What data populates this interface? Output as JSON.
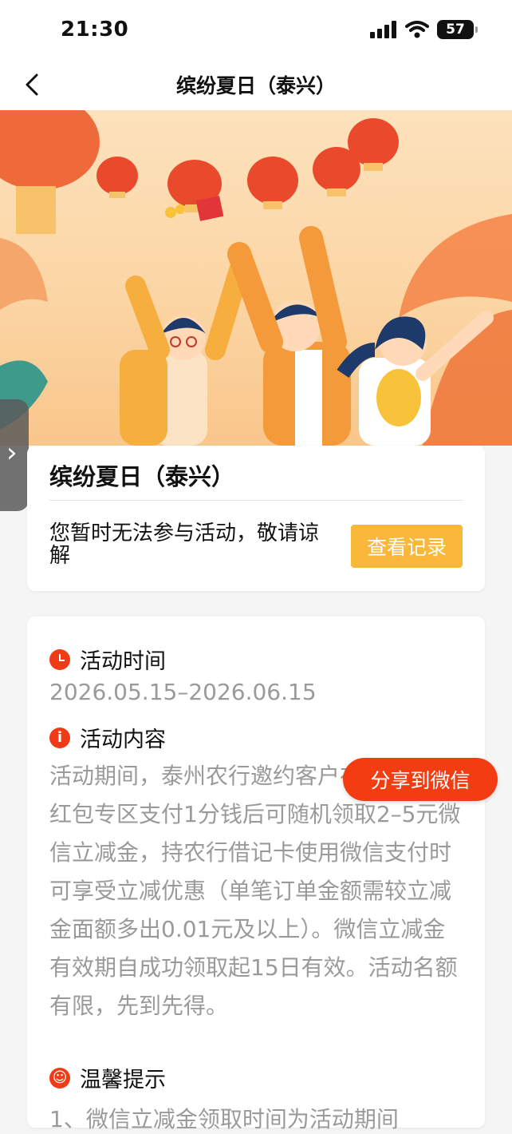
{
  "status_bar": {
    "time": "21:30",
    "battery": "57"
  },
  "nav": {
    "title": "缤纷夏日（泰兴）"
  },
  "info_card": {
    "title": "缤纷夏日（泰兴）",
    "message": "您暂时无法参与活动，敬请谅解",
    "record_button": "查看记录"
  },
  "detail_card": {
    "time_label": "活动时间",
    "time_range": "2026.05.15–2026.06.15",
    "content_label": "活动内容",
    "content_text": "活动期间，泰州农行邀约客户在农行掌银红包专区支付1分钱后可随机领取2–5元微信立减金，持农行借记卡使用微信支付时可享受立减优惠（单笔订单金额需较立减金面额多出0.01元及以上）。微信立减金有效期自成功领取起15日有效。活动名额有限，先到先得。",
    "tips_label": "温馨提示",
    "tips_partial": "1、微信立减金领取时间为活动期间"
  },
  "share_button": "分享到微信",
  "icons": {
    "back": "chevron-left-icon",
    "signal": "signal-icon",
    "wifi": "wifi-icon",
    "battery": "battery-icon",
    "clock": "clock-icon",
    "info": "info-icon",
    "smile": "smile-icon",
    "handle": "chevron-right-icon"
  },
  "colors": {
    "accent_orange": "#f23c12",
    "button_yellow": "#f9b83a",
    "muted_text": "#9a9a9a"
  }
}
